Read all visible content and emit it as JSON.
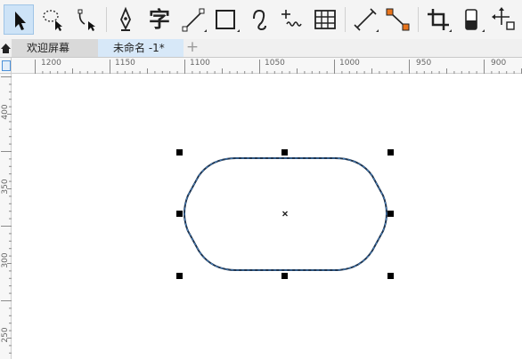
{
  "toolbar": {
    "tools": [
      "pick-tool",
      "freehand-pick-tool",
      "shape-edit-tool",
      "pen-tool",
      "text-tool",
      "line-tool",
      "rectangle-tool",
      "spiral-tool",
      "measure-tool",
      "table-tool",
      "dimension-tool",
      "connector-tool",
      "crop-tool",
      "eraser-tool",
      "transform-tool"
    ],
    "text_tool_glyph": "字"
  },
  "tabs": [
    {
      "label": "欢迎屏幕",
      "active": false
    },
    {
      "label": "未命名 -1*",
      "active": true
    }
  ],
  "tab_add_label": "+",
  "ruler": {
    "horizontal_labels": [
      "1200",
      "1150",
      "1100",
      "1050",
      "1000",
      "950",
      "900"
    ],
    "vertical_labels": [
      "400",
      "350",
      "300",
      "250"
    ]
  },
  "colors": {
    "accent": "#4a90d9",
    "active_tab": "#d7e8f8",
    "orange_node": "#e8741c",
    "selection_outline": "#1f3550"
  }
}
